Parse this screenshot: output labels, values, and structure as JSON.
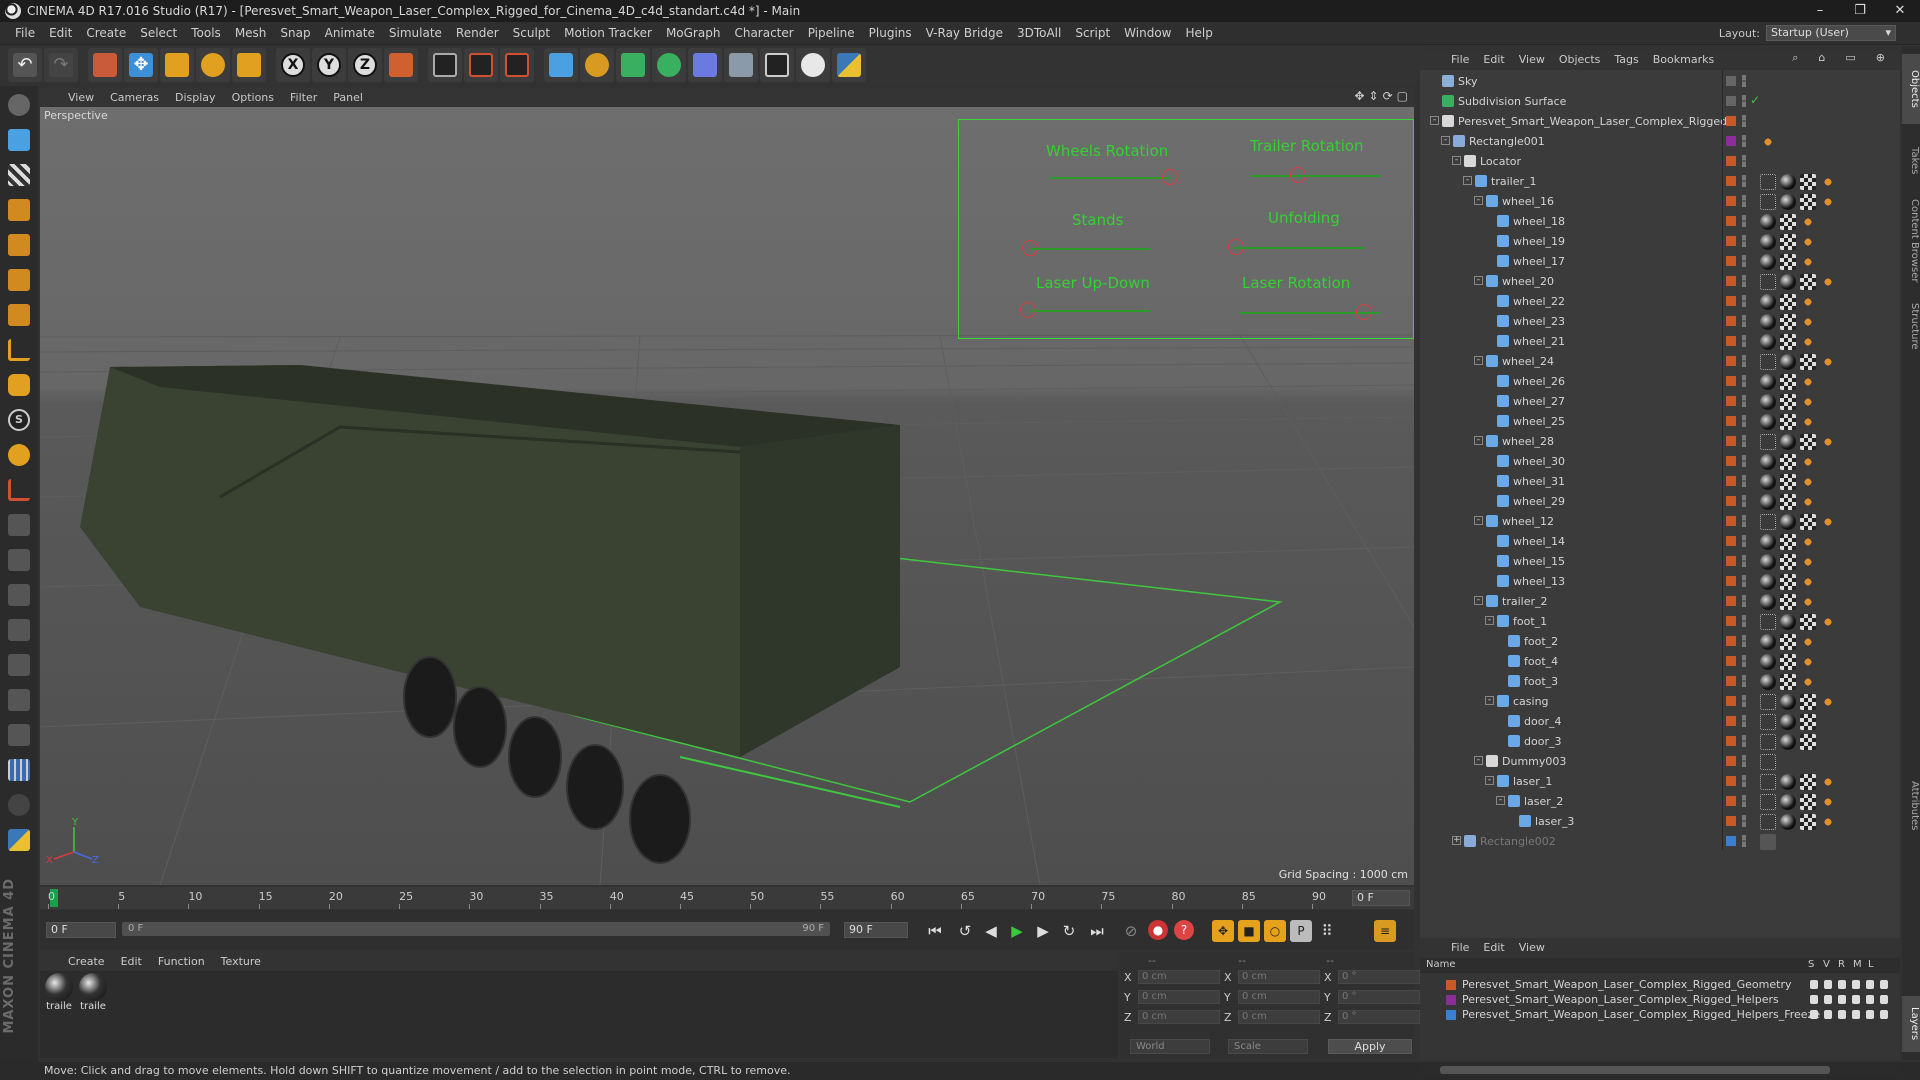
{
  "window": {
    "title": "CINEMA 4D R17.016 Studio (R17) - [Peresvet_Smart_Weapon_Laser_Complex_Rigged_for_Cinema_4D_c4d_standart.c4d *] - Main"
  },
  "menu": [
    "File",
    "Edit",
    "Create",
    "Select",
    "Tools",
    "Mesh",
    "Snap",
    "Animate",
    "Simulate",
    "Render",
    "Sculpt",
    "Motion Tracker",
    "MoGraph",
    "Character",
    "Pipeline",
    "Plugins",
    "V-Ray Bridge",
    "3DToAll",
    "Script",
    "Window",
    "Help"
  ],
  "layout": {
    "label": "Layout:",
    "value": "Startup (User)"
  },
  "viewport": {
    "menu": [
      "View",
      "Cameras",
      "Display",
      "Options",
      "Filter",
      "Panel"
    ],
    "camera_label": "Perspective",
    "grid_spacing": "Grid Spacing : 1000 cm",
    "hud": {
      "wheels_rotation": "Wheels Rotation",
      "trailer_rotation": "Trailer Rotation",
      "stands": "Stands",
      "unfolding": "Unfolding",
      "laser_up_down": "Laser Up-Down",
      "laser_rotation": "Laser Rotation"
    },
    "axis": {
      "y": "Y",
      "x": "X",
      "z": "Z"
    }
  },
  "timeline": {
    "ticks": [
      "0",
      "5",
      "10",
      "15",
      "20",
      "25",
      "30",
      "35",
      "40",
      "45",
      "50",
      "55",
      "60",
      "65",
      "70",
      "75",
      "80",
      "85",
      "90"
    ],
    "current_frame": "0 F",
    "start_field": "0 F",
    "range_start": "0 F",
    "range_end": "90 F",
    "end_field": "90 F"
  },
  "materials": {
    "menu": [
      "Create",
      "Edit",
      "Function",
      "Texture"
    ],
    "items": [
      {
        "label": "traile"
      },
      {
        "label": "traile"
      }
    ]
  },
  "coords": {
    "rows": [
      {
        "a": "X",
        "v1": "0 cm",
        "b": "X",
        "v2": "0 cm",
        "c": "X",
        "v3": "0 °"
      },
      {
        "a": "Y",
        "v1": "0 cm",
        "b": "Y",
        "v2": "0 cm",
        "c": "Y",
        "v3": "0 °"
      },
      {
        "a": "Z",
        "v1": "0 cm",
        "b": "Z",
        "v2": "0 cm",
        "c": "Z",
        "v3": "0 °"
      }
    ],
    "header1": "--",
    "header2": "--",
    "header3": "--",
    "space": "World",
    "mode": "Scale",
    "apply": "Apply"
  },
  "status": "Move: Click and drag to move elements. Hold down SHIFT to quantize movement / add to the selection in point mode, CTRL to remove.",
  "objects": {
    "menu": [
      "File",
      "Edit",
      "View",
      "Objects",
      "Tags",
      "Bookmarks"
    ],
    "tree": [
      {
        "name": "Sky",
        "depth": 0,
        "exp": "",
        "icon": "sky",
        "tags": []
      },
      {
        "name": "Subdivision Surface",
        "depth": 0,
        "exp": "",
        "icon": "subdiv",
        "tags": []
      },
      {
        "name": "Peresvet_Smart_Weapon_Laser_Complex_Rigged",
        "depth": 0,
        "exp": "-",
        "icon": "null",
        "tags": []
      },
      {
        "name": "Rectangle001",
        "depth": 1,
        "exp": "-",
        "icon": "spline",
        "tags": [
          "o"
        ]
      },
      {
        "name": "Locator",
        "depth": 2,
        "exp": "-",
        "icon": "null",
        "tags": []
      },
      {
        "name": "trailer_1",
        "depth": 3,
        "exp": "-",
        "icon": "poly",
        "tags": [
          "d",
          "m",
          "c",
          "o"
        ]
      },
      {
        "name": "wheel_16",
        "depth": 4,
        "exp": "-",
        "icon": "poly",
        "tags": [
          "d",
          "m",
          "c",
          "o"
        ]
      },
      {
        "name": "wheel_18",
        "depth": 5,
        "exp": "",
        "icon": "poly",
        "tags": [
          "m",
          "c",
          "o"
        ]
      },
      {
        "name": "wheel_19",
        "depth": 5,
        "exp": "",
        "icon": "poly",
        "tags": [
          "m",
          "c",
          "o"
        ]
      },
      {
        "name": "wheel_17",
        "depth": 5,
        "exp": "",
        "icon": "poly",
        "tags": [
          "m",
          "c",
          "o"
        ]
      },
      {
        "name": "wheel_20",
        "depth": 4,
        "exp": "-",
        "icon": "poly",
        "tags": [
          "d",
          "m",
          "c",
          "o"
        ]
      },
      {
        "name": "wheel_22",
        "depth": 5,
        "exp": "",
        "icon": "poly",
        "tags": [
          "m",
          "c",
          "o"
        ]
      },
      {
        "name": "wheel_23",
        "depth": 5,
        "exp": "",
        "icon": "poly",
        "tags": [
          "m",
          "c",
          "o"
        ]
      },
      {
        "name": "wheel_21",
        "depth": 5,
        "exp": "",
        "icon": "poly",
        "tags": [
          "m",
          "c",
          "o"
        ]
      },
      {
        "name": "wheel_24",
        "depth": 4,
        "exp": "-",
        "icon": "poly",
        "tags": [
          "d",
          "m",
          "c",
          "o"
        ]
      },
      {
        "name": "wheel_26",
        "depth": 5,
        "exp": "",
        "icon": "poly",
        "tags": [
          "m",
          "c",
          "o"
        ]
      },
      {
        "name": "wheel_27",
        "depth": 5,
        "exp": "",
        "icon": "poly",
        "tags": [
          "m",
          "c",
          "o"
        ]
      },
      {
        "name": "wheel_25",
        "depth": 5,
        "exp": "",
        "icon": "poly",
        "tags": [
          "m",
          "c",
          "o"
        ]
      },
      {
        "name": "wheel_28",
        "depth": 4,
        "exp": "-",
        "icon": "poly",
        "tags": [
          "d",
          "m",
          "c",
          "o"
        ]
      },
      {
        "name": "wheel_30",
        "depth": 5,
        "exp": "",
        "icon": "poly",
        "tags": [
          "m",
          "c",
          "o"
        ]
      },
      {
        "name": "wheel_31",
        "depth": 5,
        "exp": "",
        "icon": "poly",
        "tags": [
          "m",
          "c",
          "o"
        ]
      },
      {
        "name": "wheel_29",
        "depth": 5,
        "exp": "",
        "icon": "poly",
        "tags": [
          "m",
          "c",
          "o"
        ]
      },
      {
        "name": "wheel_12",
        "depth": 4,
        "exp": "-",
        "icon": "poly",
        "tags": [
          "d",
          "m",
          "c",
          "o"
        ]
      },
      {
        "name": "wheel_14",
        "depth": 5,
        "exp": "",
        "icon": "poly",
        "tags": [
          "m",
          "c",
          "o"
        ]
      },
      {
        "name": "wheel_15",
        "depth": 5,
        "exp": "",
        "icon": "poly",
        "tags": [
          "m",
          "c",
          "o"
        ]
      },
      {
        "name": "wheel_13",
        "depth": 5,
        "exp": "",
        "icon": "poly",
        "tags": [
          "m",
          "c",
          "o"
        ]
      },
      {
        "name": "trailer_2",
        "depth": 4,
        "exp": "-",
        "icon": "poly",
        "tags": [
          "m",
          "c",
          "o"
        ]
      },
      {
        "name": "foot_1",
        "depth": 5,
        "exp": "-",
        "icon": "poly",
        "tags": [
          "d",
          "m",
          "c",
          "o"
        ]
      },
      {
        "name": "foot_2",
        "depth": 6,
        "exp": "",
        "icon": "poly",
        "tags": [
          "m",
          "c",
          "o"
        ]
      },
      {
        "name": "foot_4",
        "depth": 6,
        "exp": "",
        "icon": "poly",
        "tags": [
          "m",
          "c",
          "o"
        ]
      },
      {
        "name": "foot_3",
        "depth": 6,
        "exp": "",
        "icon": "poly",
        "tags": [
          "m",
          "c",
          "o"
        ]
      },
      {
        "name": "casing",
        "depth": 5,
        "exp": "-",
        "icon": "poly",
        "tags": [
          "d",
          "m",
          "c",
          "o"
        ]
      },
      {
        "name": "door_4",
        "depth": 6,
        "exp": "",
        "icon": "poly",
        "tags": [
          "d",
          "m",
          "c"
        ]
      },
      {
        "name": "door_3",
        "depth": 6,
        "exp": "",
        "icon": "poly",
        "tags": [
          "d",
          "m",
          "c"
        ]
      },
      {
        "name": "Dummy003",
        "depth": 4,
        "exp": "-",
        "icon": "null",
        "tags": [
          "d"
        ]
      },
      {
        "name": "laser_1",
        "depth": 5,
        "exp": "-",
        "icon": "poly",
        "tags": [
          "d",
          "m",
          "c",
          "o"
        ]
      },
      {
        "name": "laser_2",
        "depth": 6,
        "exp": "-",
        "icon": "poly",
        "tags": [
          "d",
          "m",
          "c",
          "o"
        ]
      },
      {
        "name": "laser_3",
        "depth": 7,
        "exp": "",
        "icon": "poly",
        "tags": [
          "d",
          "m",
          "c",
          "o"
        ]
      },
      {
        "name": "Rectangle002",
        "depth": 2,
        "exp": "+",
        "icon": "spline",
        "tags": [
          "g"
        ]
      }
    ]
  },
  "layers": {
    "menu": [
      "File",
      "Edit",
      "View"
    ],
    "header": {
      "name": "Name",
      "s": "S",
      "v": "V",
      "r": "R",
      "m": "M",
      "l": "L"
    },
    "rows": [
      {
        "name": "Peresvet_Smart_Weapon_Laser_Complex_Rigged_Geometry",
        "color": "#c85a28"
      },
      {
        "name": "Peresvet_Smart_Weapon_Laser_Complex_Rigged_Helpers",
        "color": "#8a2f9a"
      },
      {
        "name": "Peresvet_Smart_Weapon_Laser_Complex_Rigged_Helpers_Freeze",
        "color": "#3a7fd0"
      }
    ]
  },
  "side_tabs": [
    "Objects",
    "Takes",
    "Content Browser",
    "Structure",
    "Attributes",
    "Layers"
  ],
  "brand": "MAXON CINEMA 4D"
}
